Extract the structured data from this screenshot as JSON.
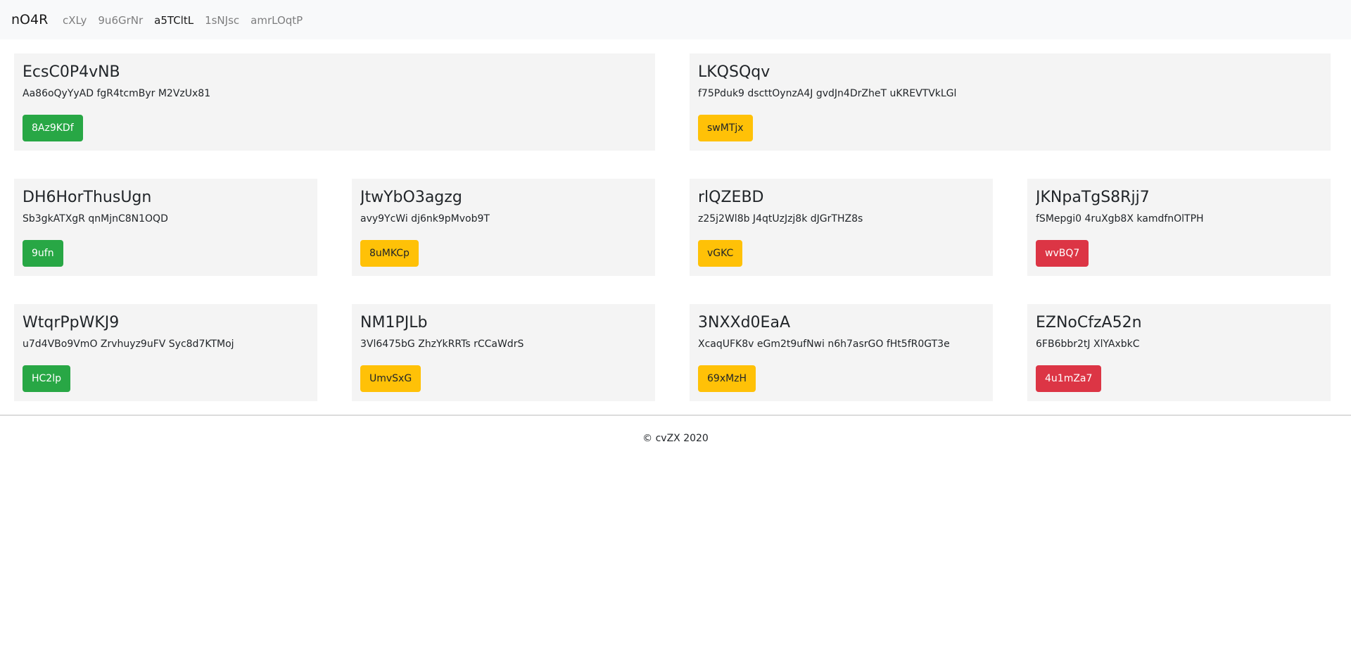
{
  "navbar": {
    "brand": "nO4R",
    "links": [
      {
        "label": "cXLy"
      },
      {
        "label": "9u6GrNr"
      },
      {
        "label": "a5TCltL"
      },
      {
        "label": "1sNJsc"
      },
      {
        "label": "amrLOqtP"
      }
    ]
  },
  "rows": [
    {
      "cards": [
        {
          "title": "EcsC0P4vNB",
          "text": "Aa86oQyYyAD fgR4tcmByr M2VzUx81",
          "button": "8Az9KDf",
          "button_style": "success"
        },
        {
          "title": "LKQSQqv",
          "text": "f75Pduk9 dscttOynzA4J gvdJn4DrZheT uKREVTVkLGl",
          "button": "swMTjx",
          "button_style": "warning"
        }
      ]
    },
    {
      "cards": [
        {
          "title": "DH6HorThusUgn",
          "text": "Sb3gkATXgR qnMjnC8N1OQD",
          "button": "9ufn",
          "button_style": "success"
        },
        {
          "title": "JtwYbO3agzg",
          "text": "avy9YcWi dj6nk9pMvob9T",
          "button": "8uMKCp",
          "button_style": "warning"
        },
        {
          "title": "rlQZEBD",
          "text": "z25j2Wl8b J4qtUzJzj8k dJGrTHZ8s",
          "button": "vGKC",
          "button_style": "warning"
        },
        {
          "title": "JKNpaTgS8Rjj7",
          "text": "fSMepgi0 4ruXgb8X kamdfnOlTPH",
          "button": "wvBQ7",
          "button_style": "danger"
        }
      ]
    },
    {
      "cards": [
        {
          "title": "WtqrPpWKJ9",
          "text": "u7d4VBo9VmO Zrvhuyz9uFV Syc8d7KTMoj",
          "button": "HC2lp",
          "button_style": "success"
        },
        {
          "title": "NM1PJLb",
          "text": "3Vl6475bG ZhzYkRRTs rCCaWdrS",
          "button": "UmvSxG",
          "button_style": "warning"
        },
        {
          "title": "3NXXd0EaA",
          "text": "XcaqUFK8v eGm2t9ufNwi n6h7asrGO fHt5fR0GT3e",
          "button": "69xMzH",
          "button_style": "warning"
        },
        {
          "title": "EZNoCfzA52n",
          "text": "6FB6bbr2tJ XlYAxbkC",
          "button": "4u1mZa7",
          "button_style": "danger"
        }
      ]
    }
  ],
  "footer": {
    "text": "© cvZX 2020"
  }
}
